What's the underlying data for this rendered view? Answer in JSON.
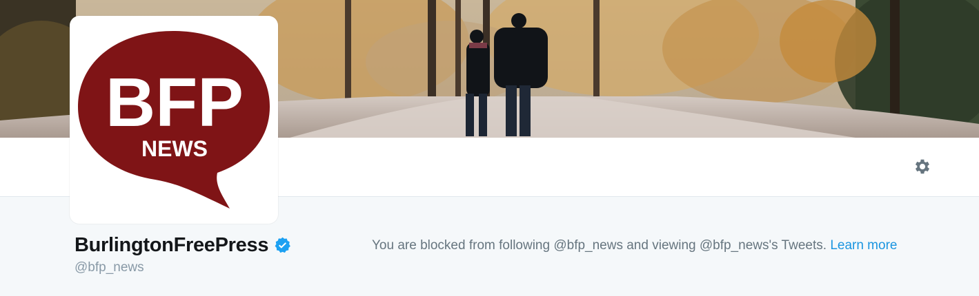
{
  "banner": {
    "alt": "autumn forest path with two people walking"
  },
  "avatar": {
    "logo_text_main": "BFP",
    "logo_text_sub": "NEWS",
    "brand_color": "#7f1416"
  },
  "profile": {
    "name": "BurlingtonFreePress",
    "handle": "@bfp_news",
    "verified": true
  },
  "notice": {
    "text": "You are blocked from following @bfp_news and viewing @bfp_news's Tweets.",
    "link_label": "Learn more"
  },
  "icons": {
    "settings": "gear-icon",
    "verified": "verified-badge-icon"
  },
  "colors": {
    "link": "#1b95e0",
    "verified": "#1da1f2",
    "muted": "#8899a6",
    "canvas": "#f5f8fa"
  }
}
